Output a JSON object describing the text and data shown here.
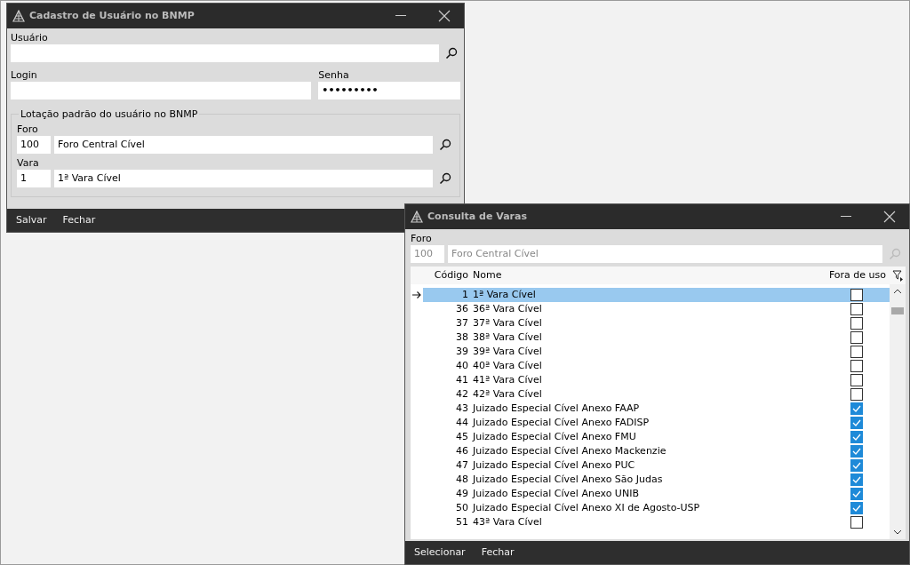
{
  "cadastro_window": {
    "title": "Cadastro de Usuário no BNMP",
    "usuario": {
      "label": "Usuário"
    },
    "login": {
      "label": "Login"
    },
    "senha": {
      "label": "Senha",
      "value": "•••••••••"
    },
    "lotacao": {
      "legend": "Lotação padrão do usuário no BNMP",
      "foro": {
        "label": "Foro",
        "code": "100",
        "name": "Foro Central Cível"
      },
      "vara": {
        "label": "Vara",
        "code": "1",
        "name": "1ª Vara Cível"
      }
    },
    "buttons": [
      "Salvar",
      "Fechar"
    ]
  },
  "consulta_window": {
    "title": "Consulta de Varas",
    "foro": {
      "label": "Foro",
      "code": "100",
      "name": "Foro Central Cível",
      "disabled": true
    },
    "table": {
      "columns": [
        "Código",
        "Nome",
        "Fora de uso"
      ],
      "rows": [
        {
          "codigo": "1",
          "nome": "1ª Vara Cível",
          "fora_de_uso": false,
          "selected": true
        },
        {
          "codigo": "36",
          "nome": "36ª Vara Cível",
          "fora_de_uso": false,
          "selected": false
        },
        {
          "codigo": "37",
          "nome": "37ª Vara Cível",
          "fora_de_uso": false,
          "selected": false
        },
        {
          "codigo": "38",
          "nome": "38ª Vara Cível",
          "fora_de_uso": false,
          "selected": false
        },
        {
          "codigo": "39",
          "nome": "39ª Vara Cível",
          "fora_de_uso": false,
          "selected": false
        },
        {
          "codigo": "40",
          "nome": "40ª Vara Cível",
          "fora_de_uso": false,
          "selected": false
        },
        {
          "codigo": "41",
          "nome": "41ª Vara Cível",
          "fora_de_uso": false,
          "selected": false
        },
        {
          "codigo": "42",
          "nome": "42ª Vara Cível",
          "fora_de_uso": false,
          "selected": false
        },
        {
          "codigo": "43",
          "nome": "Juizado Especial Cível Anexo FAAP",
          "fora_de_uso": true,
          "selected": false
        },
        {
          "codigo": "44",
          "nome": "Juizado Especial Cível Anexo FADISP",
          "fora_de_uso": true,
          "selected": false
        },
        {
          "codigo": "45",
          "nome": "Juizado Especial Cível Anexo FMU",
          "fora_de_uso": true,
          "selected": false
        },
        {
          "codigo": "46",
          "nome": "Juizado Especial Cível Anexo Mackenzie",
          "fora_de_uso": true,
          "selected": false
        },
        {
          "codigo": "47",
          "nome": "Juizado Especial Cível Anexo PUC",
          "fora_de_uso": true,
          "selected": false
        },
        {
          "codigo": "48",
          "nome": "Juizado Especial Cível Anexo São Judas",
          "fora_de_uso": true,
          "selected": false
        },
        {
          "codigo": "49",
          "nome": "Juizado Especial Cível Anexo UNIB",
          "fora_de_uso": true,
          "selected": false
        },
        {
          "codigo": "50",
          "nome": "Juizado Especial Cível Anexo XI de Agosto-USP",
          "fora_de_uso": true,
          "selected": false
        },
        {
          "codigo": "51",
          "nome": "43ª Vara Cível",
          "fora_de_uso": false,
          "selected": false
        }
      ]
    },
    "buttons": [
      "Selecionar",
      "Fechar"
    ]
  }
}
